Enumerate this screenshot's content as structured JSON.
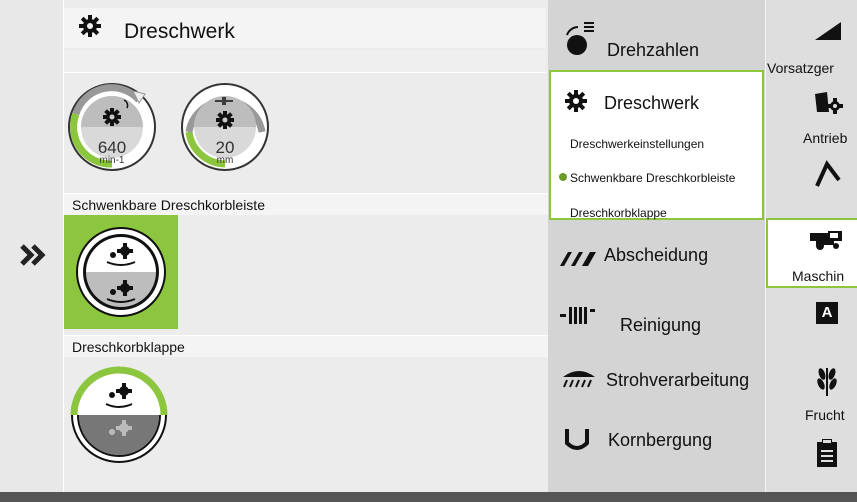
{
  "header": {
    "title": "Dreschwerk"
  },
  "gauges": [
    {
      "value": "640",
      "unit": "min-1",
      "level": 0.45
    },
    {
      "value": "20",
      "unit": "mm",
      "level": 0.3
    }
  ],
  "sections": {
    "korbleiste": "Schwenkbare Dreschkorbleiste",
    "korbklappe": "Dreschkorbklappe"
  },
  "menu": {
    "drehzahlen": "Drehzahlen",
    "dreschwerk": "Dreschwerk",
    "sub1": "Dreschwerkeinstellungen",
    "sub2": "Schwenkbare Dreschkorbleiste",
    "sub3": "Dreschkorbklappe",
    "abscheidung": "Abscheidung",
    "reinigung": "Reinigung",
    "stroh": "Strohverarbeitung",
    "korn": "Kornbergung"
  },
  "right": {
    "vorsatz": "Vorsatzger",
    "antrieb": "Antrieb",
    "maschine": "Maschin",
    "frucht": "Frucht",
    "a_letter": "A"
  },
  "colors": {
    "accent": "#8cc63f",
    "bg": "#e6e6e6"
  }
}
